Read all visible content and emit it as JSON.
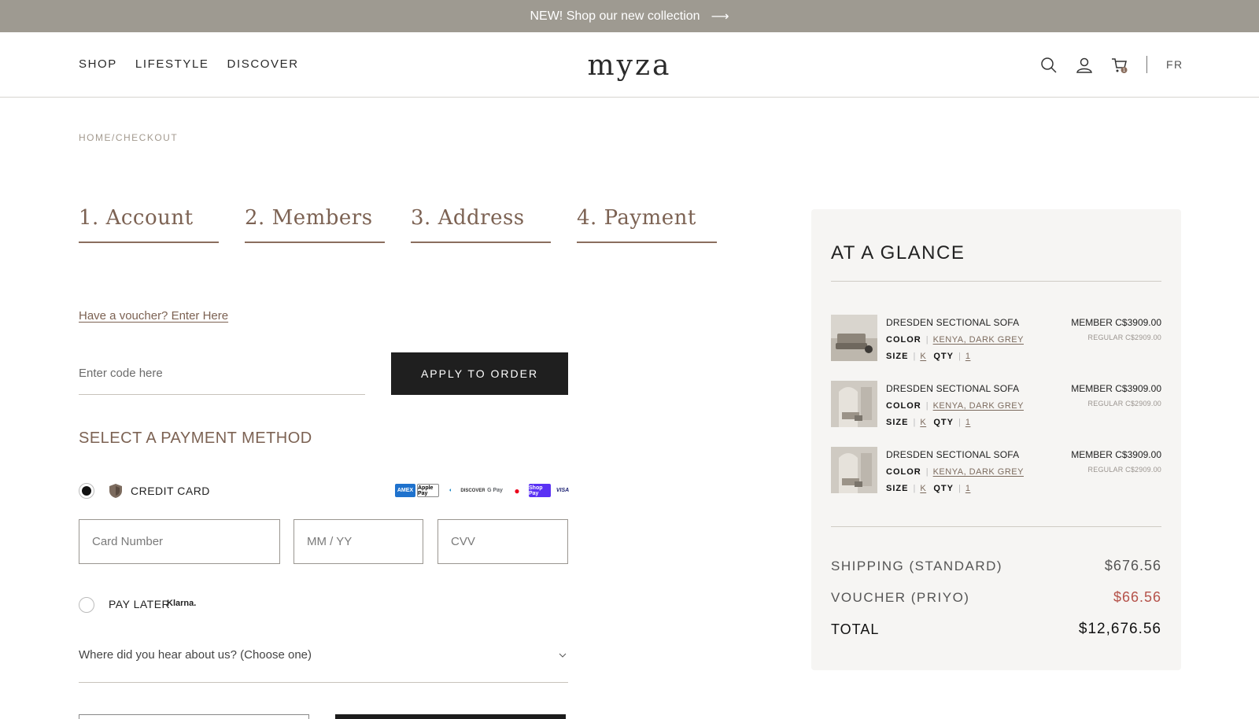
{
  "promo": {
    "text": "NEW! Shop our new collection",
    "arrow": "⟶"
  },
  "header": {
    "nav": [
      "SHOP",
      "LIFESTYLE",
      "DISCOVER"
    ],
    "logo": "myza",
    "lang": "FR",
    "cart_count": "1",
    "icons": [
      "search-icon",
      "account-icon",
      "cart-icon"
    ]
  },
  "breadcrumb": "HOME/CHECKOUT",
  "steps": [
    "1. Account",
    "2. Members",
    "3. Address",
    "4. Payment"
  ],
  "voucher": {
    "link": "Have a voucher? Enter Here",
    "placeholder": "Enter code here",
    "apply_label": "APPLY TO ORDER"
  },
  "payment": {
    "title": "SELECT A PAYMENT METHOD",
    "credit_card_label": "CREDIT CARD",
    "card_logos": [
      "AMEX",
      "Apple Pay",
      "Diners",
      "DISCOVER",
      "G Pay",
      "Mastercard",
      "Shop Pay",
      "VISA"
    ],
    "card_number_placeholder": "Card Number",
    "expiry_placeholder": "MM / YY",
    "cvv_placeholder": "CVV",
    "pay_later_label": "PAY LATER",
    "klarna": "Klarna.",
    "hear_about": "Where did you hear about us? (Choose one)"
  },
  "summary": {
    "title": "AT A GLANCE",
    "items": [
      {
        "name": "DRESDEN SECTIONAL SOFA",
        "color_label": "COLOR",
        "color": "KENYA, DARK GREY",
        "size_label": "SIZE",
        "size": "K",
        "qty_label": "QTY",
        "qty": "1",
        "member": "MEMBER C$3909.00",
        "regular": "REGULAR C$2909.00"
      },
      {
        "name": "DRESDEN SECTIONAL SOFA",
        "color_label": "COLOR",
        "color": "KENYA, DARK GREY",
        "size_label": "SIZE",
        "size": "K",
        "qty_label": "QTY",
        "qty": "1",
        "member": "MEMBER C$3909.00",
        "regular": "REGULAR C$2909.00"
      },
      {
        "name": "DRESDEN SECTIONAL SOFA",
        "color_label": "COLOR",
        "color": "KENYA, DARK GREY",
        "size_label": "SIZE",
        "size": "K",
        "qty_label": "QTY",
        "qty": "1",
        "member": "MEMBER C$3909.00",
        "regular": "REGULAR C$2909.00"
      }
    ],
    "shipping_label": "SHIPPING (STANDARD)",
    "shipping_value": "$676.56",
    "voucher_label": "VOUCHER (PRIYO)",
    "voucher_value": "$66.56",
    "total_label": "TOTAL",
    "total_value": "$12,676.56"
  },
  "colors": {
    "promo_bg": "#9e9a91",
    "accent_brown": "#7c6253",
    "voucher_red": "#b5524a",
    "button_dark": "#1f1f1f",
    "panel_bg": "#f6f5f3"
  }
}
